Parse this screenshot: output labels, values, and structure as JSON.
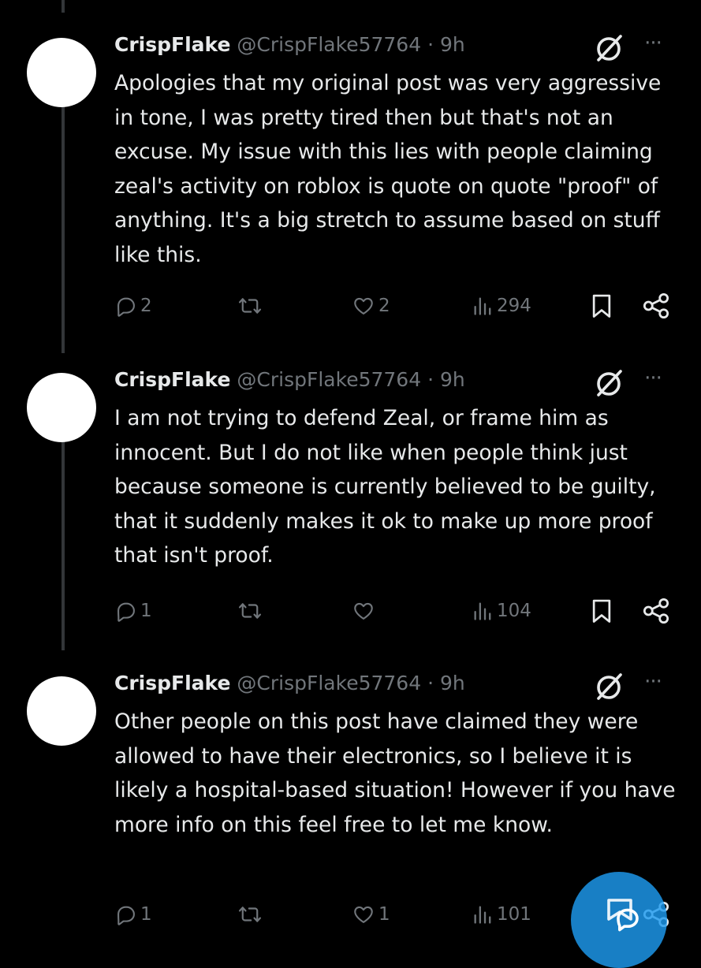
{
  "posts": [
    {
      "name": "CrispFlake",
      "handle": "@CrispFlake57764",
      "time": "· 9h",
      "text": "Apologies that my original post was very aggressive in tone, I was pretty tired then but that's not an excuse. My issue with this lies with people claiming zeal's activity on roblox is quote on quote \"proof\" of anything. It's a big stretch to assume based on stuff like this.",
      "replies": "2",
      "reposts": "",
      "likes": "2",
      "views": "294"
    },
    {
      "name": "CrispFlake",
      "handle": "@CrispFlake57764",
      "time": "· 9h",
      "text": "I am not trying to defend Zeal, or frame him as innocent. But I do not like when people think just because someone is currently believed to be guilty, that it suddenly makes it ok to make up more proof that isn't proof.",
      "replies": "1",
      "reposts": "",
      "likes": "",
      "views": "104"
    },
    {
      "name": "CrispFlake",
      "handle": "@CrispFlake57764",
      "time": "· 9h",
      "text": "Other people on this post have claimed they were allowed to have their electronics, so I believe it is likely a hospital-based situation! However if you have more info on this feel free to let me know.",
      "replies": "1",
      "reposts": "",
      "likes": "1",
      "views": "101"
    }
  ],
  "icons": {
    "more": "···",
    "reply": "reply-icon",
    "repost": "repost-icon",
    "like": "like-icon",
    "views": "views-icon",
    "bookmark": "bookmark-icon",
    "share": "share-icon",
    "grok": "grok-icon",
    "compose": "new-message-icon"
  },
  "colors": {
    "background": "#000000",
    "text": "#e7e9ea",
    "secondary": "#71767b",
    "accent": "#1d9bf0",
    "thread_line": "#333639"
  }
}
